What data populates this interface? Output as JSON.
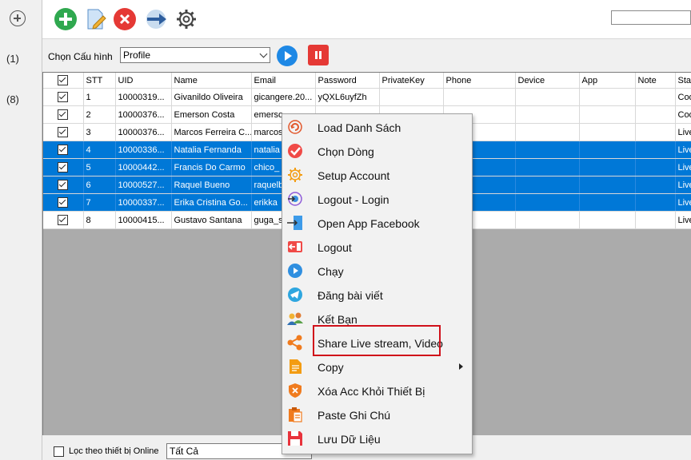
{
  "sidebar": {
    "counts": [
      "(1)",
      "(8)"
    ]
  },
  "toolbar": {
    "search_value": ""
  },
  "profile": {
    "label": "Chọn Cấu hình",
    "selected": "Profile"
  },
  "grid": {
    "columns": [
      "",
      "STT",
      "UID",
      "Name",
      "Email",
      "Password",
      "PrivateKey",
      "Phone",
      "Device",
      "App",
      "Note",
      "Sta"
    ],
    "rows": [
      {
        "checked": true,
        "selected": false,
        "stt": "1",
        "uid": "10000319...",
        "name": "Givanildo Oliveira",
        "email": "gicangere.20...",
        "password": "yQXL6uyfZh",
        "status": "Coo"
      },
      {
        "checked": true,
        "selected": false,
        "stt": "2",
        "uid": "10000376...",
        "name": "Emerson Costa",
        "email": "emerso",
        "password": "",
        "status": "Coo"
      },
      {
        "checked": true,
        "selected": false,
        "stt": "3",
        "uid": "10000376...",
        "name": "Marcos Ferreira C...",
        "email": "marcos",
        "password": "",
        "status": "Live"
      },
      {
        "checked": true,
        "selected": true,
        "stt": "4",
        "uid": "10000336...",
        "name": "Natalia Fernanda",
        "email": "natalia",
        "password": "",
        "status": "Live"
      },
      {
        "checked": true,
        "selected": true,
        "stt": "5",
        "uid": "10000442...",
        "name": "Francis Do Carmo",
        "email": "chico_",
        "password": "",
        "status": "Live"
      },
      {
        "checked": true,
        "selected": true,
        "stt": "6",
        "uid": "10000527...",
        "name": "Raquel Bueno",
        "email": "raquelb",
        "password": "",
        "status": "Live"
      },
      {
        "checked": true,
        "selected": true,
        "stt": "7",
        "uid": "10000337...",
        "name": "Erika Cristina Go...",
        "email": "erikka",
        "password": "",
        "status": "Live"
      },
      {
        "checked": true,
        "selected": false,
        "stt": "8",
        "uid": "10000415...",
        "name": "Gustavo Santana",
        "email": "guga_s",
        "password": "",
        "status": "Live"
      }
    ]
  },
  "bottom": {
    "filter_label": "Lọc theo thiết bị Online",
    "filter_selected": "Tất Cả"
  },
  "context_menu": {
    "items": [
      {
        "label": "Load Danh Sách",
        "icon": "refresh-icon"
      },
      {
        "label": "Chọn Dòng",
        "icon": "check-circle-icon"
      },
      {
        "label": "Setup Account",
        "icon": "gear-icon"
      },
      {
        "label": "Logout - Login",
        "icon": "relogin-icon"
      },
      {
        "label": "Open App Facebook",
        "icon": "open-app-icon"
      },
      {
        "label": "Logout",
        "icon": "logout-icon"
      },
      {
        "label": "Chạy",
        "icon": "play-icon"
      },
      {
        "label": "Đăng bài viết",
        "icon": "telegram-icon"
      },
      {
        "label": "Kết Bạn",
        "icon": "friends-icon"
      },
      {
        "label": "Share Live stream, Video",
        "icon": "share-icon"
      },
      {
        "label": "Copy",
        "icon": "document-icon",
        "submenu": true
      },
      {
        "label": "Xóa Acc Khỏi Thiết Bị",
        "icon": "shield-x-icon"
      },
      {
        "label": "Paste Ghi Chú",
        "icon": "clipboard-icon"
      },
      {
        "label": "Lưu Dữ Liệu",
        "icon": "save-icon"
      }
    ],
    "highlighted": "Share Live stream, Video"
  },
  "colors": {
    "selection": "#0078d7",
    "highlight_border": "#d0101a",
    "play": "#1e88e5",
    "stop": "#e53935"
  }
}
